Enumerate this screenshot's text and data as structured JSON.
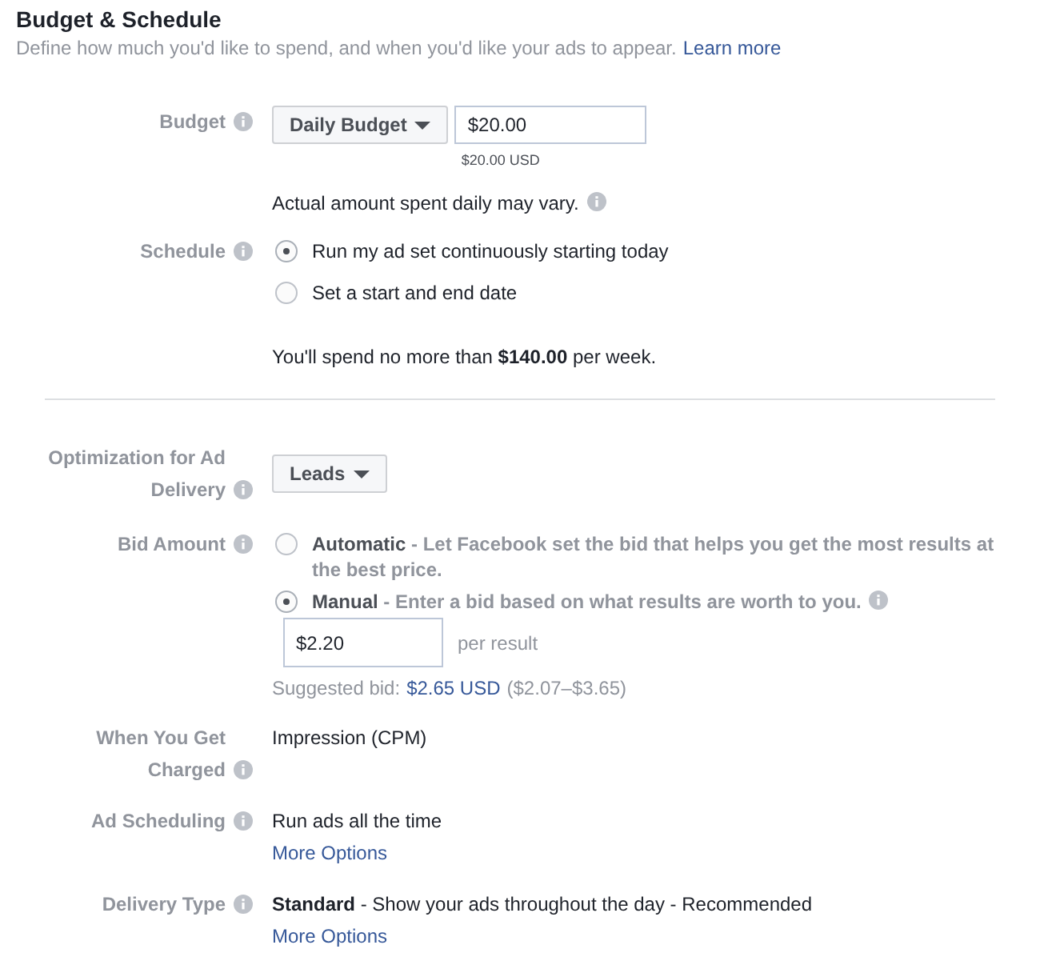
{
  "header": {
    "title": "Budget & Schedule",
    "description": "Define how much you'd like to spend, and when you'd like your ads to appear.",
    "link": "Learn more"
  },
  "sections": [
    {
      "rows": [
        {
          "kind": "budget",
          "label": "Budget",
          "dropdown": "Daily Budget",
          "value": "$20.00",
          "note": "$20.00 USD",
          "hint": "Actual amount spent daily may vary."
        },
        {
          "kind": "radio",
          "label": "Schedule",
          "options": [
            {
              "text": "Run my ad set continuously starting today",
              "selected": true
            },
            {
              "text": "Set a start and end date",
              "selected": false
            }
          ]
        },
        {
          "kind": "summary",
          "text": "You'll spend no more than **$140.00** per week."
        }
      ]
    },
    {
      "rows": [
        {
          "kind": "dropdown",
          "label": "Optimization for Ad Delivery",
          "dropdown": "Leads"
        },
        {
          "kind": "radio-detail",
          "label": "Bid Amount",
          "options": [
            {
              "text": "**Automatic** - Let Facebook set the bid that helps you get the most results at the best price.",
              "selected": false
            },
            {
              "text": "**Manual** - Enter a bid based on what results are worth to you.",
              "selected": true,
              "info": true
            }
          ],
          "bid": {
            "value": "$2.20",
            "unit": "per result",
            "suggestion_label": "Suggested bid:",
            "suggestion_value": "$2.65 USD",
            "suggestion_range": "($2.07–$3.65)"
          }
        },
        {
          "kind": "text",
          "label": "When You Get Charged",
          "text": "Impression (CPM)"
        },
        {
          "kind": "text",
          "label": "Ad Scheduling",
          "text": "Run ads all the time",
          "link": "More Options"
        },
        {
          "kind": "text",
          "label": "Delivery Type",
          "text": "**Standard** - Show your ads throughout the day - Recommended",
          "link": "More Options"
        }
      ]
    }
  ]
}
